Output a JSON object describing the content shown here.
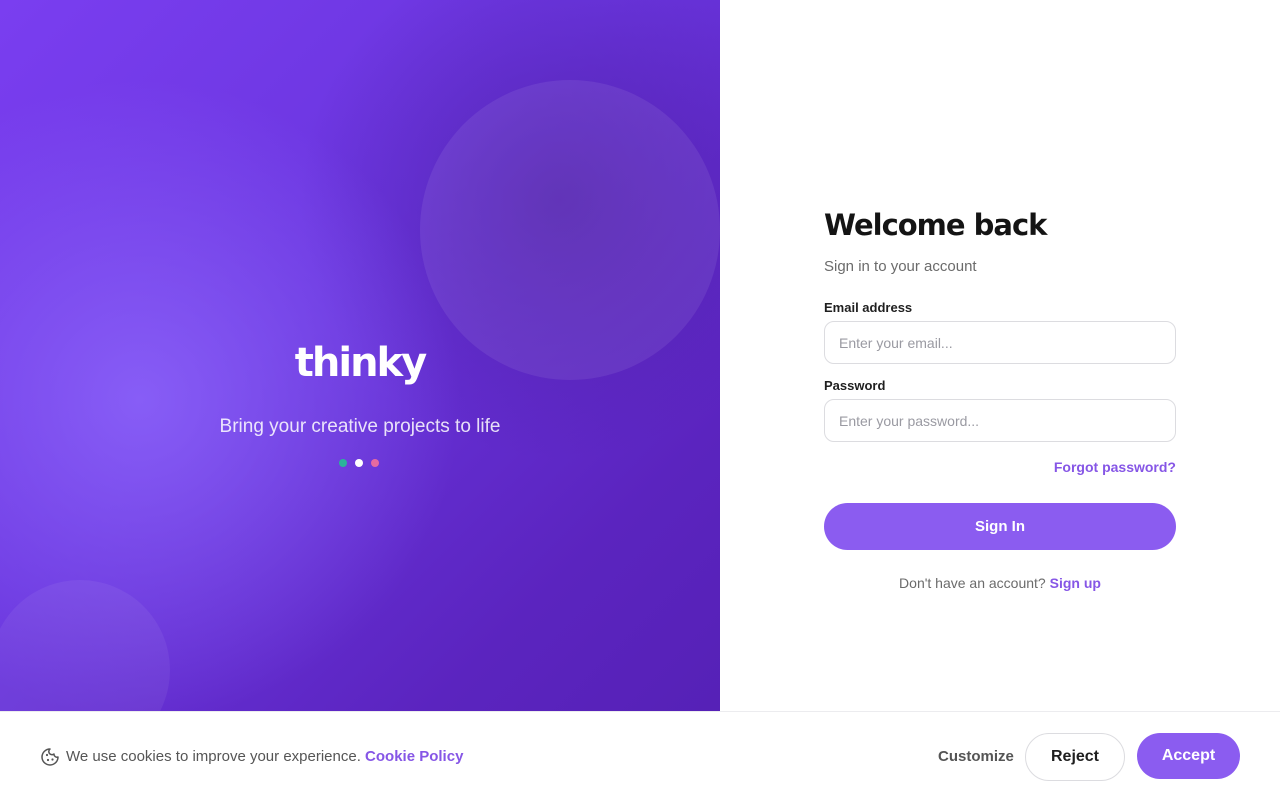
{
  "hero": {
    "brand": "thinky",
    "tagline": "Bring your creative projects to life",
    "dots": [
      {
        "color": "#2bb39a"
      },
      {
        "color": "#ffffff"
      },
      {
        "color": "#e66aa0"
      }
    ]
  },
  "auth": {
    "title": "Welcome back",
    "subtitle": "Sign in to your account",
    "email_label": "Email address",
    "email_placeholder": "Enter your email...",
    "email_value": "",
    "password_label": "Password",
    "password_placeholder": "Enter your password...",
    "password_value": "",
    "forgot_link": "Forgot password?",
    "signin_button": "Sign In",
    "signup_prompt": "Don't have an account?",
    "signup_link": "Sign up"
  },
  "cookie": {
    "icon": "cookie-icon",
    "message": "We use cookies to improve your experience.",
    "policy_link": "Cookie Policy",
    "customize": "Customize",
    "reject": "Reject",
    "accept": "Accept"
  },
  "colors": {
    "accent": "#8b5cf0",
    "link": "#8656e6",
    "hero_gradient_start": "#7a3ef0",
    "hero_gradient_end": "#5420b4"
  }
}
